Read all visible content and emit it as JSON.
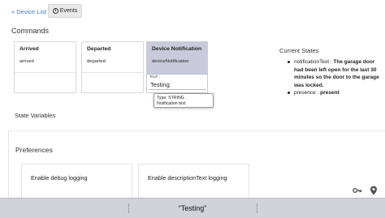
{
  "nav": {
    "device_list_label": "« Device List",
    "events_label": "Events",
    "events_icon": "info-icon"
  },
  "commands": {
    "title": "Commands",
    "cards": [
      {
        "name": "Arrived",
        "method": "arrived"
      },
      {
        "name": "Departed",
        "method": "departed"
      },
      {
        "name": "Device Notification",
        "method": "deviceNotification"
      }
    ],
    "notification_param_label": "Text* :",
    "notification_text_value": "Testing",
    "tooltip": {
      "type_line": "Type: STRING",
      "desc_line": "Notification text"
    }
  },
  "current_states": {
    "title": "Current States",
    "items": [
      {
        "key": "notificationText : ",
        "value": "The garage door had been left open for the last 30 minutes so the door to the garage was locked."
      },
      {
        "key": "presence : ",
        "value": "present"
      }
    ]
  },
  "state_variables": {
    "title": "State Variables"
  },
  "preferences": {
    "title": "Preferences",
    "items": [
      {
        "label": "Enable debug logging"
      },
      {
        "label": "Enable descriptionText logging"
      }
    ]
  },
  "toolbar": {
    "key_icon": "key-icon",
    "location_icon": "location-pin-icon"
  },
  "keyboard": {
    "suggestions": [
      "",
      "“Testing”",
      ""
    ]
  },
  "colors": {
    "link": "#3b78c4",
    "selected_card_header": "#c9cbdc",
    "keyboard_bar": "#d1d3d9"
  }
}
